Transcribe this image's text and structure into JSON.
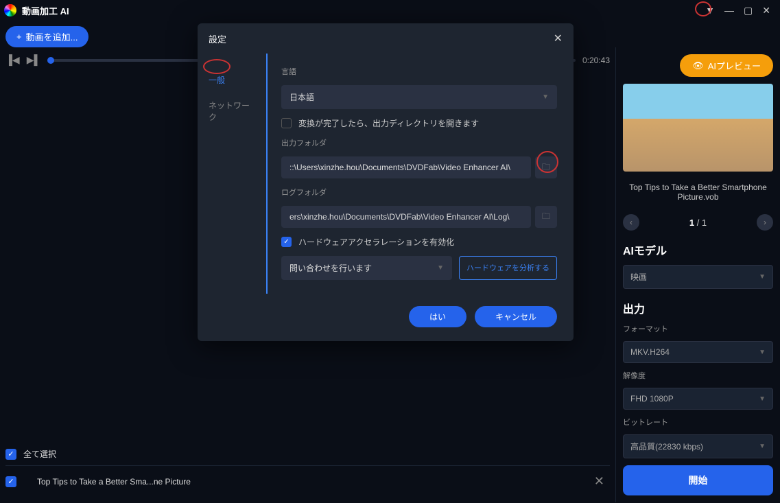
{
  "titlebar": {
    "title": "動画加工 AI"
  },
  "toolbar": {
    "add_video": "動画を追加..."
  },
  "playback": {
    "time": "0:20:43"
  },
  "list": {
    "select_all": "全て選択",
    "item": "Top Tips to Take a Better Sma...ne Picture"
  },
  "right": {
    "preview_btn": "AIプレビュー",
    "caption": "Top Tips to Take a Better Smartphone Picture.vob",
    "page_current": "1",
    "page_total": "1",
    "ai_model_title": "AIモデル",
    "ai_model_value": "映画",
    "output_title": "出力",
    "format_label": "フォーマット",
    "format_value": "MKV.H264",
    "resolution_label": "解像度",
    "resolution_value": "FHD 1080P",
    "bitrate_label": "ビットレート",
    "bitrate_value": "高品質(22830 kbps)",
    "start_btn": "開始"
  },
  "dialog": {
    "title": "設定",
    "tab_general": "一般",
    "tab_network": "ネットワーク",
    "language_label": "言語",
    "language_value": "日本語",
    "open_output_label": "変換が完了したら、出力ディレクトリを開きます",
    "output_folder_label": "出力フォルダ",
    "output_folder_path": "::\\Users\\xinzhe.hou\\Documents\\DVDFab\\Video Enhancer AI\\",
    "log_folder_label": "ログフォルダ",
    "log_folder_path": "ers\\xinzhe.hou\\Documents\\DVDFab\\Video Enhancer AI\\Log\\",
    "hw_accel_label": "ハードウェアアクセラレーションを有効化",
    "hw_query_value": "問い合わせを行います",
    "hw_analyze_btn": "ハードウェアを分析する",
    "ok_btn": "はい",
    "cancel_btn": "キャンセル"
  }
}
